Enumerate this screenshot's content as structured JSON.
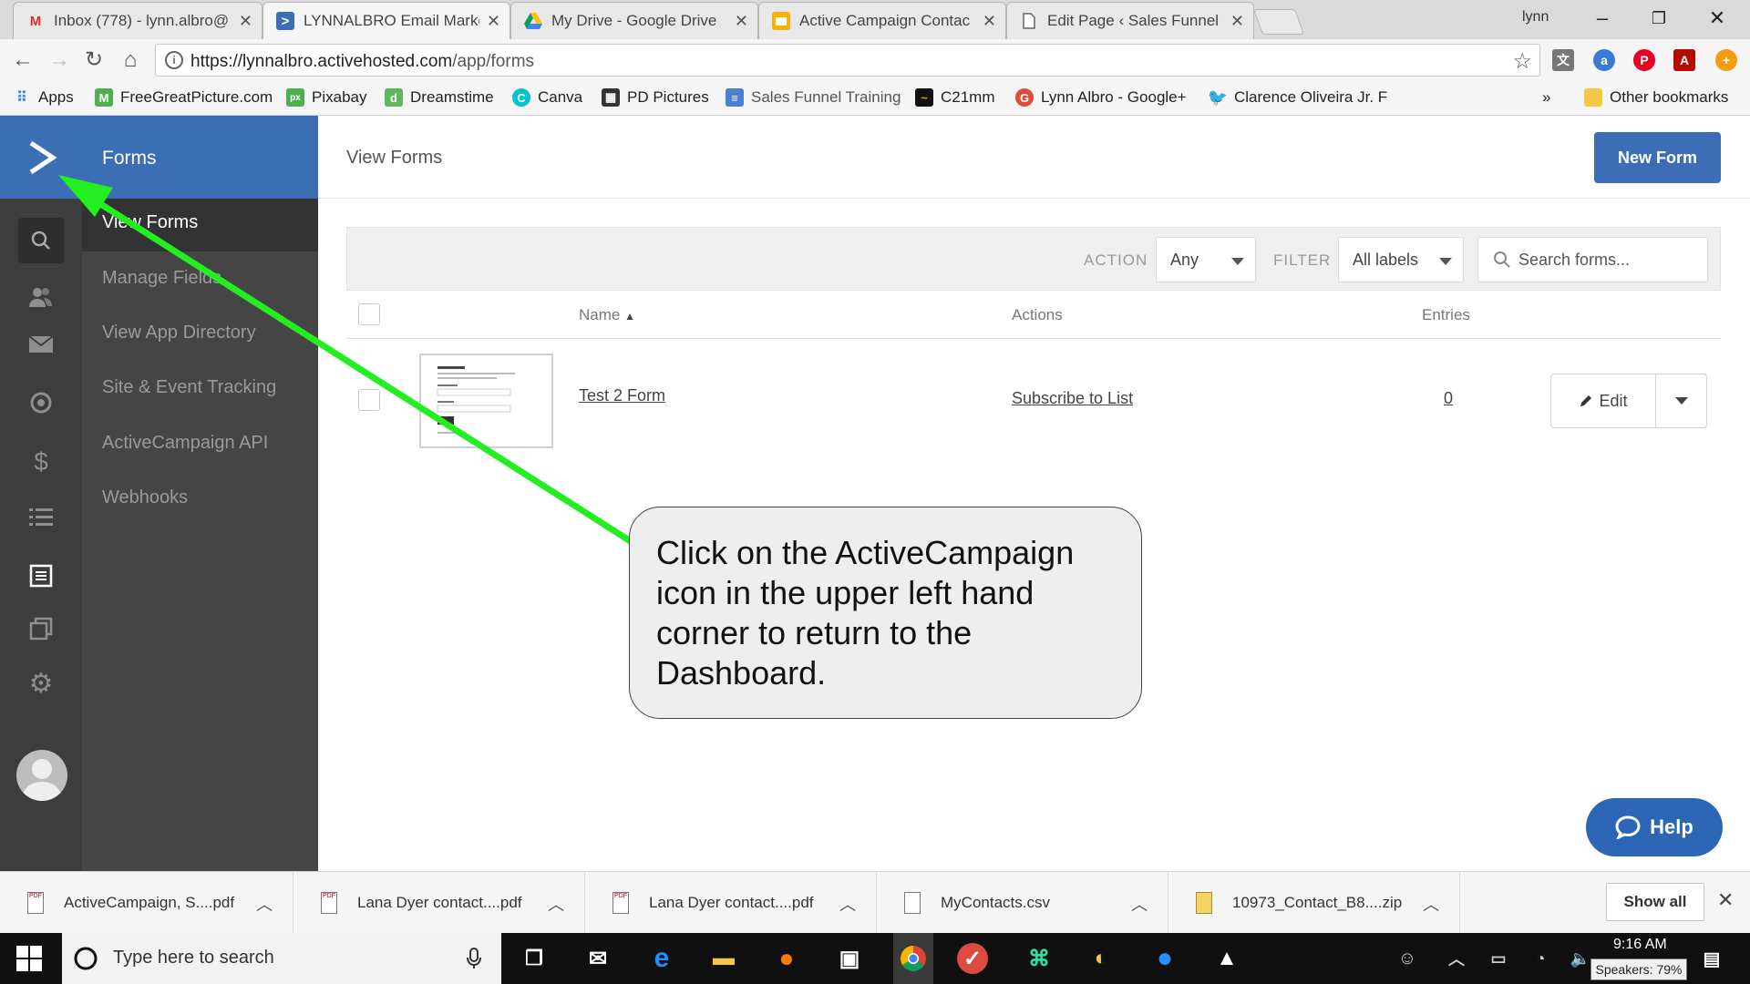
{
  "browser": {
    "tabs": [
      {
        "title": "Inbox (778) - lynn.albro@",
        "icon": "gmail-icon"
      },
      {
        "title": "LYNNALBRO Email Marke",
        "icon": "activecampaign-icon"
      },
      {
        "title": "My Drive - Google Drive",
        "icon": "google-drive-icon"
      },
      {
        "title": "Active Campaign Contac",
        "icon": "google-slides-icon"
      },
      {
        "title": "Edit Page ‹ Sales Funnel T",
        "icon": "page-icon"
      }
    ],
    "profile_name": "lynn",
    "url_host": "https://lynnalbro.activehosted.com",
    "url_path": "/app/forms",
    "bookmarks": [
      {
        "label": "Apps"
      },
      {
        "label": "FreeGreatPicture.com"
      },
      {
        "label": "Pixabay"
      },
      {
        "label": "Dreamstime"
      },
      {
        "label": "Canva"
      },
      {
        "label": "PD Pictures"
      },
      {
        "label": "Sales Funnel Training"
      },
      {
        "label": "C21mm"
      },
      {
        "label": "Lynn Albro - Google+"
      },
      {
        "label": "Clarence Oliveira Jr. F"
      }
    ],
    "bookmarks_overflow": "»",
    "other_bookmarks": "Other bookmarks"
  },
  "app": {
    "section": "Forms",
    "subnav": [
      {
        "label": "View Forms",
        "active": true
      },
      {
        "label": "Manage Fields"
      },
      {
        "label": "View App Directory"
      },
      {
        "label": "Site & Event Tracking"
      },
      {
        "label": "ActiveCampaign API"
      },
      {
        "label": "Webhooks"
      }
    ],
    "icons": [
      "search-icon",
      "contacts-icon",
      "campaigns-icon",
      "automations-icon",
      "deals-icon",
      "lists-icon",
      "forms-icon",
      "pages-icon",
      "settings-icon"
    ],
    "accent": "#3b6eb4"
  },
  "main": {
    "title": "View Forms",
    "new_form_label": "New Form",
    "filters": {
      "action_label": "ACTION",
      "action_value": "Any",
      "filter_label": "FILTER",
      "filter_value": "All labels",
      "search_placeholder": "Search forms..."
    },
    "table": {
      "columns": {
        "name": "Name",
        "actions": "Actions",
        "entries": "Entries"
      },
      "rows": [
        {
          "name": "Test 2 Form",
          "action": "Subscribe to List",
          "entries": "0",
          "edit_label": "Edit"
        }
      ]
    },
    "help_label": "Help"
  },
  "callout": {
    "text": "Click on the ActiveCampaign icon in the upper left hand corner to return to the Dashboard.",
    "arrow_color": "#22ee22"
  },
  "downloads": {
    "items": [
      {
        "name": "ActiveCampaign, S....pdf"
      },
      {
        "name": "Lana Dyer contact....pdf"
      },
      {
        "name": "Lana Dyer contact....pdf"
      },
      {
        "name": "MyContacts.csv"
      },
      {
        "name": "10973_Contact_B8....zip"
      }
    ],
    "show_all": "Show all"
  },
  "taskbar": {
    "search_placeholder": "Type here to search",
    "time": "9:16 AM",
    "tooltip": "Speakers: 79%"
  }
}
